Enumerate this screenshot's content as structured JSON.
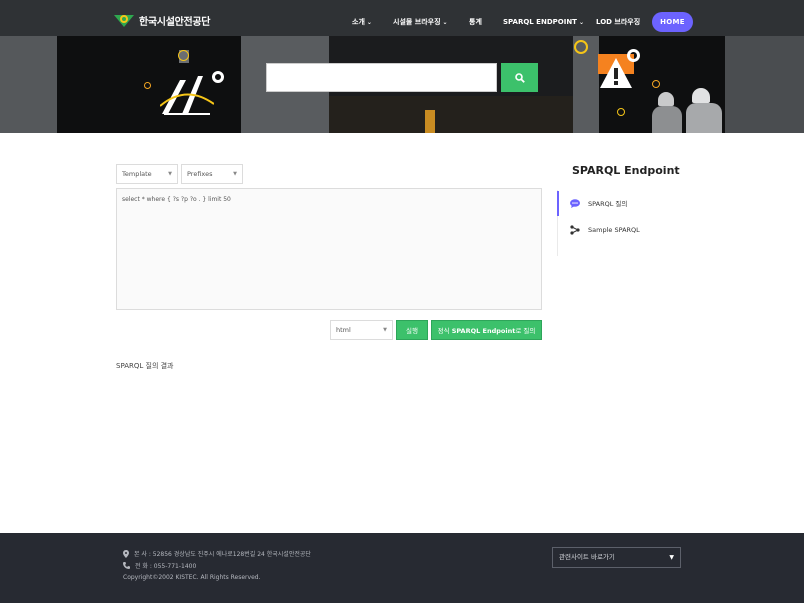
{
  "header": {
    "logo_text": "한국시설안전공단",
    "nav": [
      {
        "label": "소개",
        "has_dropdown": true
      },
      {
        "label": "시설물 브라우징",
        "has_dropdown": true
      },
      {
        "label": "통계",
        "has_dropdown": false
      },
      {
        "label": "SPARQL ENDPOINT",
        "has_dropdown": true
      },
      {
        "label": "LOD 브라우징",
        "has_dropdown": false
      }
    ],
    "home_label": "HOME",
    "search_value": ""
  },
  "toolbar": {
    "template_label": "Template",
    "prefixes_label": "Prefixes"
  },
  "query": {
    "text": "select * where { ?s ?p ?o . } limit 50"
  },
  "actions": {
    "format_value": "html",
    "run_label": "실행",
    "official_label_prefix": "정식 ",
    "official_label_strong": "SPARQL Endpoint",
    "official_label_suffix": "로 질의"
  },
  "results": {
    "label": "SPARQL 질의 결과"
  },
  "sidebar": {
    "title": "SPARQL Endpoint",
    "items": [
      {
        "label": "SPARQL 질의",
        "icon": "chat-bubble-icon",
        "active": true
      },
      {
        "label": "Sample SPARQL",
        "icon": "share-nodes-icon",
        "active": false
      }
    ]
  },
  "footer": {
    "address": "본 사 : 52856 경상남도 진주시 에나로128번길 24 한국시설안전공단",
    "phone": "전 화 : 055-771-1400",
    "copyright": "Copyright©2002 KISTEC. All Rights Reserved.",
    "related_sites_label": "관련사이트 바로가기"
  },
  "colors": {
    "accent_purple": "#6c63ff",
    "accent_green": "#3cc16b",
    "footer_bg": "#272a32",
    "ring_yellow": "#f5c518"
  }
}
